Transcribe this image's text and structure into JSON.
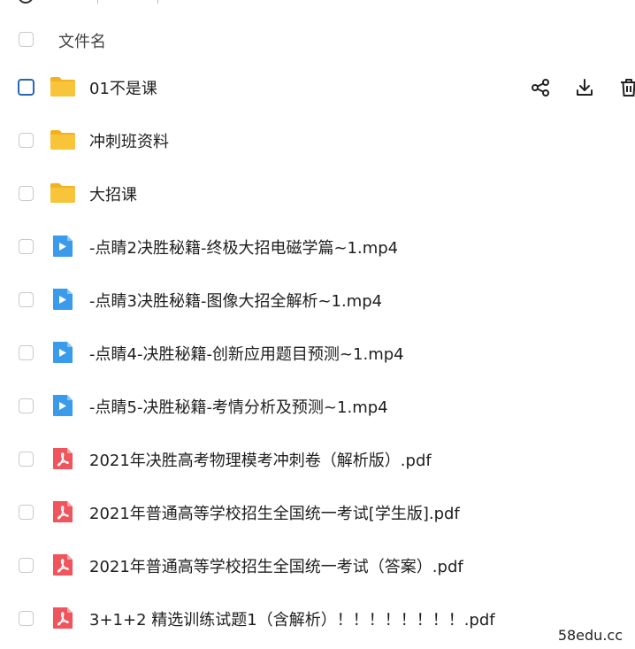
{
  "header": {
    "column_name": "文件名"
  },
  "files": [
    {
      "name": "01不是课",
      "type": "folder",
      "icon": "folder-icon",
      "checked_focus": true,
      "show_actions": true
    },
    {
      "name": "冲刺班资料",
      "type": "folder",
      "icon": "folder-icon"
    },
    {
      "name": "大招课",
      "type": "folder",
      "icon": "folder-icon"
    },
    {
      "name": "-点睛2决胜秘籍-终极大招电磁学篇~1.mp4",
      "type": "video",
      "icon": "video-file-icon"
    },
    {
      "name": "-点睛3决胜秘籍-图像大招全解析~1.mp4",
      "type": "video",
      "icon": "video-file-icon"
    },
    {
      "name": "-点睛4-决胜秘籍-创新应用题目预测~1.mp4",
      "type": "video",
      "icon": "video-file-icon"
    },
    {
      "name": "-点睛5-决胜秘籍-考情分析及预测~1.mp4",
      "type": "video",
      "icon": "video-file-icon"
    },
    {
      "name": "2021年决胜高考物理模考冲刺卷（解析版）.pdf",
      "type": "pdf",
      "icon": "pdf-file-icon"
    },
    {
      "name": "2021年普通高等学校招生全国统一考试[学生版].pdf",
      "type": "pdf",
      "icon": "pdf-file-icon"
    },
    {
      "name": "2021年普通高等学校招生全国统一考试（答案）.pdf",
      "type": "pdf",
      "icon": "pdf-file-icon"
    },
    {
      "name": "3+1+2 精选训练试题1（含解析）！！！！！！！！.pdf",
      "type": "pdf",
      "icon": "pdf-file-icon"
    }
  ],
  "row_actions": [
    "share-icon",
    "download-icon",
    "delete-icon"
  ],
  "watermark": "58edu.cc",
  "colors": {
    "folder": "#F8C53A",
    "folder_tab": "#F2B21F",
    "video": "#3A9BEA",
    "pdf": "#F0545C",
    "checkbox_focus": "#2A64B8"
  }
}
